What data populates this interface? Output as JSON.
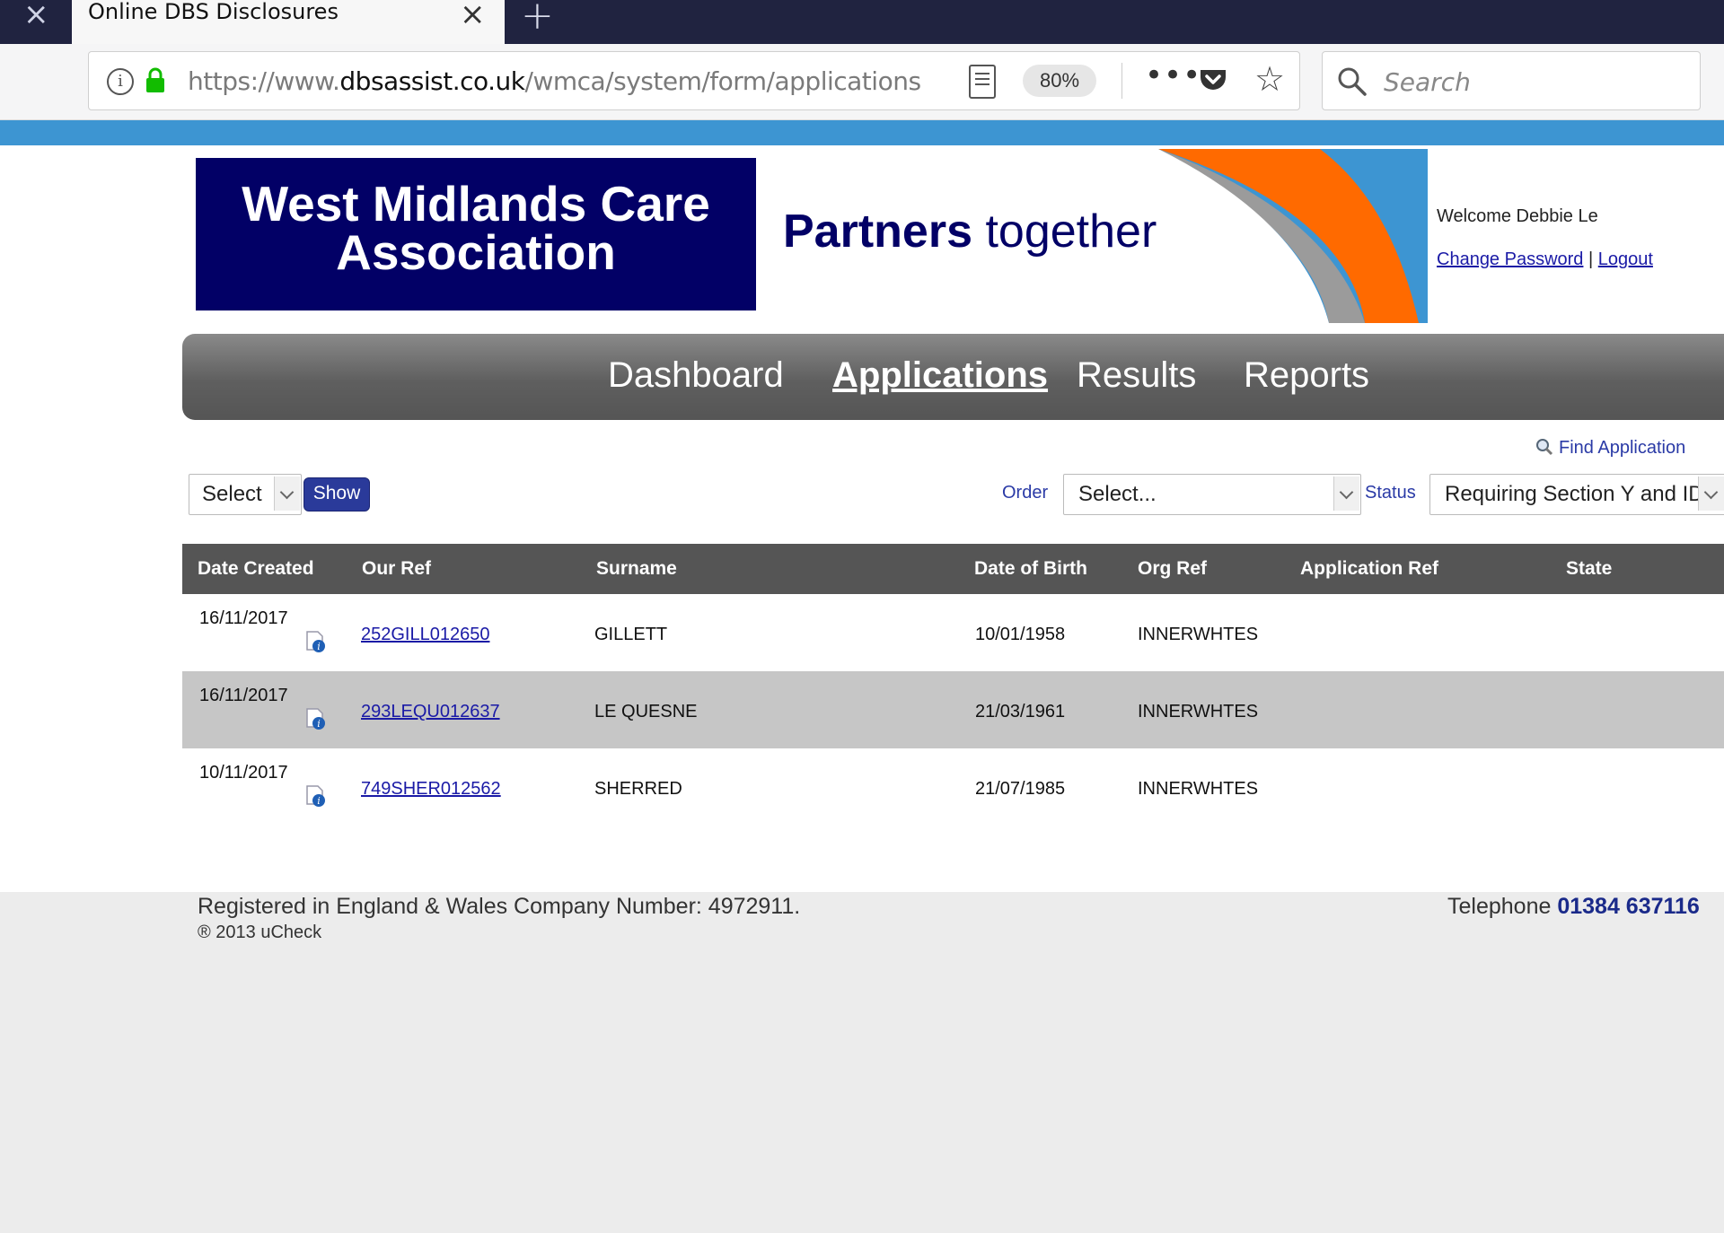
{
  "browser": {
    "tab_title": "Online DBS Disclosures",
    "url_prefix": "https://www.",
    "url_host": "dbsassist.co.uk",
    "url_path": "/wmca/system/form/applications",
    "zoom": "80%",
    "search_placeholder": "Search"
  },
  "header": {
    "logo_line1": "West Midlands Care",
    "logo_line2": "Association",
    "tagline_bold": "Partners",
    "tagline_rest": " together",
    "welcome": "Welcome Debbie Le",
    "change_password": "Change Password",
    "separator": " | ",
    "logout": "Logout",
    "colors": {
      "brand_navy": "#020066",
      "orange": "#ff6a00",
      "sky": "#3d95d2",
      "grey": "#9b9b9b"
    }
  },
  "menu": {
    "items": [
      "Dashboard",
      "Applications",
      "Results",
      "Reports"
    ],
    "active": "Applications"
  },
  "filters": {
    "find_application": "Find Application",
    "per_page_select": "Select",
    "show_button": "Show",
    "order_label": "Order",
    "order_value": "Select...",
    "status_label": "Status",
    "status_value": "Requiring Section Y and ID"
  },
  "table": {
    "columns": [
      "Date Created",
      "Our Ref",
      "Surname",
      "Date of Birth",
      "Org Ref",
      "Application Ref",
      "State"
    ],
    "rows": [
      {
        "date_created": "16/11/2017",
        "our_ref": "252GILL012650",
        "surname": "GILLETT",
        "dob": "10/01/1958",
        "org_ref": "INNERWHTES",
        "app_ref": "",
        "state": ""
      },
      {
        "date_created": "16/11/2017",
        "our_ref": "293LEQU012637",
        "surname": "LE QUESNE",
        "dob": "21/03/1961",
        "org_ref": "INNERWHTES",
        "app_ref": "",
        "state": ""
      },
      {
        "date_created": "10/11/2017",
        "our_ref": "749SHER012562",
        "surname": "SHERRED",
        "dob": "21/07/1985",
        "org_ref": "INNERWHTES",
        "app_ref": "",
        "state": ""
      }
    ]
  },
  "footer": {
    "registered": "Registered in England & Wales Company Number: 4972911.",
    "copyright": "® 2013 uCheck",
    "telephone_label": "Telephone ",
    "telephone_number": "01384 637116"
  }
}
